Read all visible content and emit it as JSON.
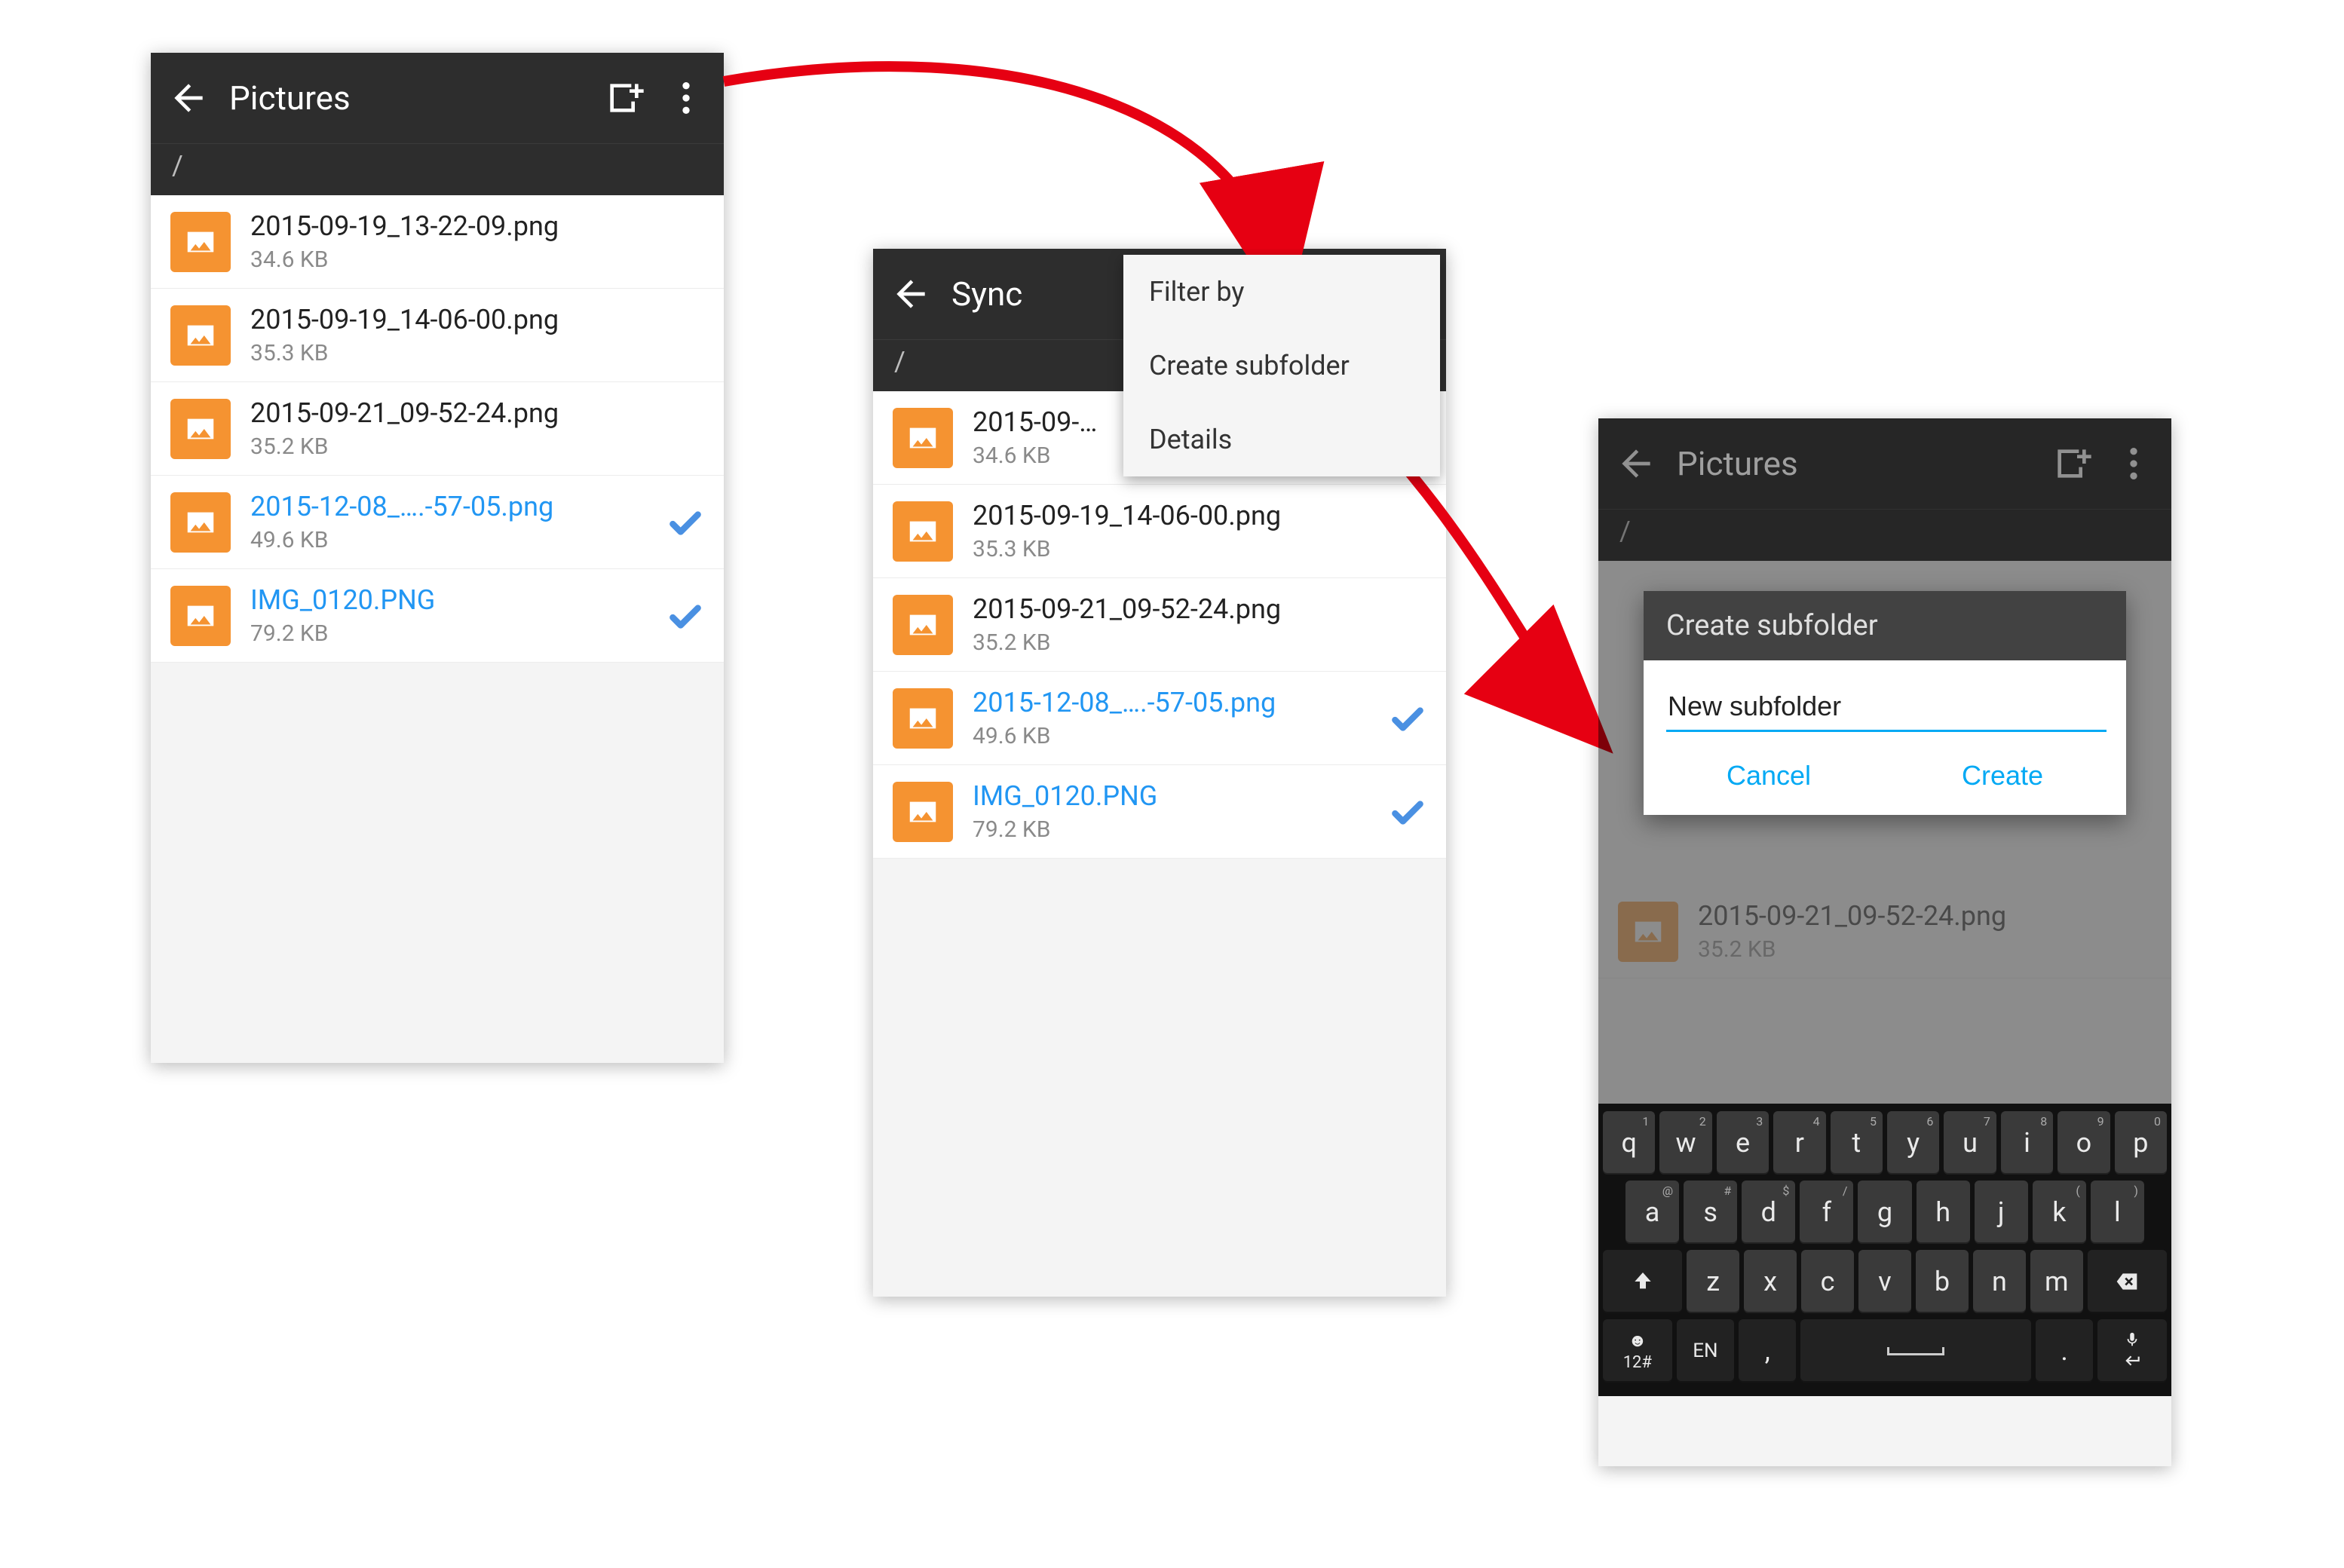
{
  "phones": {
    "p1": {
      "title": "Pictures",
      "breadcrumb": "/",
      "files": [
        {
          "name": "2015-09-19_13-22-09.png",
          "size": "34.6 KB",
          "synced": false
        },
        {
          "name": "2015-09-19_14-06-00.png",
          "size": "35.3 KB",
          "synced": false
        },
        {
          "name": "2015-09-21_09-52-24.png",
          "size": "35.2 KB",
          "synced": false
        },
        {
          "name": "2015-12-08_….-57-05.png",
          "size": "49.6 KB",
          "synced": true
        },
        {
          "name": "IMG_0120.PNG",
          "size": "79.2 KB",
          "synced": true
        }
      ]
    },
    "p2": {
      "title": "Sync",
      "breadcrumb": "/",
      "menu": [
        "Filter by",
        "Create subfolder",
        "Details"
      ],
      "files": [
        {
          "name": "2015-09-…",
          "size": "34.6 KB",
          "synced": false
        },
        {
          "name": "2015-09-19_14-06-00.png",
          "size": "35.3 KB",
          "synced": false
        },
        {
          "name": "2015-09-21_09-52-24.png",
          "size": "35.2 KB",
          "synced": false
        },
        {
          "name": "2015-12-08_….-57-05.png",
          "size": "49.6 KB",
          "synced": true
        },
        {
          "name": "IMG_0120.PNG",
          "size": "79.2 KB",
          "synced": true
        }
      ]
    },
    "p3": {
      "title": "Pictures",
      "breadcrumb": "/",
      "dialog": {
        "title": "Create subfolder",
        "input_value": "New subfolder",
        "cancel": "Cancel",
        "create": "Create"
      },
      "bg_file": {
        "name": "2015-09-21_09-52-24.png",
        "size": "35.2 KB"
      },
      "keyboard": {
        "row1": [
          {
            "k": "q",
            "s": "1"
          },
          {
            "k": "w",
            "s": "2"
          },
          {
            "k": "e",
            "s": "3"
          },
          {
            "k": "r",
            "s": "4"
          },
          {
            "k": "t",
            "s": "5"
          },
          {
            "k": "y",
            "s": "6"
          },
          {
            "k": "u",
            "s": "7"
          },
          {
            "k": "i",
            "s": "8"
          },
          {
            "k": "o",
            "s": "9"
          },
          {
            "k": "p",
            "s": "0"
          }
        ],
        "row2": [
          {
            "k": "a",
            "s": "@"
          },
          {
            "k": "s",
            "s": "#"
          },
          {
            "k": "d",
            "s": "$"
          },
          {
            "k": "f",
            "s": "/"
          },
          {
            "k": "g",
            "s": ""
          },
          {
            "k": "h",
            "s": ""
          },
          {
            "k": "j",
            "s": ""
          },
          {
            "k": "k",
            "s": "("
          },
          {
            "k": "l",
            "s": ")"
          }
        ],
        "row3": [
          {
            "k": "z",
            "s": ""
          },
          {
            "k": "x",
            "s": ""
          },
          {
            "k": "c",
            "s": ""
          },
          {
            "k": "v",
            "s": ""
          },
          {
            "k": "b",
            "s": ""
          },
          {
            "k": "n",
            "s": ""
          },
          {
            "k": "m",
            "s": ""
          }
        ],
        "sym_key": "12#",
        "lang_key": "EN",
        "comma": ",",
        "period": "."
      }
    }
  }
}
